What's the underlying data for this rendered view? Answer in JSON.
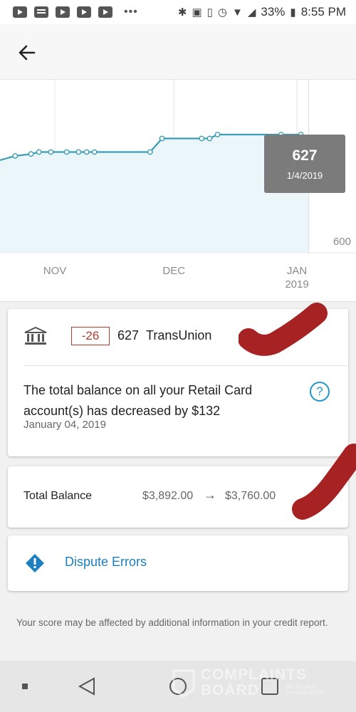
{
  "status_bar": {
    "battery": "33%",
    "time": "8:55 PM",
    "overflow": "•••",
    "app_icons": [
      "youtube-icon",
      "message-icon",
      "youtube-icon",
      "youtube-icon",
      "youtube-icon"
    ],
    "system_icons": [
      "bluetooth-icon",
      "nfc-icon",
      "vibrate-icon",
      "alarm-icon",
      "wifi-icon",
      "signal-icon",
      "battery-icon"
    ]
  },
  "app_bar": {
    "back_icon": "arrow-left-icon"
  },
  "chart_data": {
    "type": "line",
    "x_tick_labels": [
      "NOV",
      "DEC",
      "JAN\n2019"
    ],
    "y_tick_labels": [
      "600"
    ],
    "series": [
      {
        "values": [
          {
            "date": "2018-10-22",
            "score": 644
          },
          {
            "date": "2018-10-26",
            "score": 645
          },
          {
            "date": "2018-10-28",
            "score": 646
          },
          {
            "date": "2018-10-31",
            "score": 646
          },
          {
            "date": "2018-11-04",
            "score": 646
          },
          {
            "date": "2018-11-07",
            "score": 646
          },
          {
            "date": "2018-11-09",
            "score": 646
          },
          {
            "date": "2018-11-11",
            "score": 646
          },
          {
            "date": "2018-11-25",
            "score": 646
          },
          {
            "date": "2018-11-28",
            "score": 653
          },
          {
            "date": "2018-12-08",
            "score": 653
          },
          {
            "date": "2018-12-10",
            "score": 653
          },
          {
            "date": "2018-12-12",
            "score": 655
          },
          {
            "date": "2018-12-28",
            "score": 655
          },
          {
            "date": "2019-01-02",
            "score": 655
          },
          {
            "date": "2019-01-04",
            "score": 627
          }
        ]
      }
    ],
    "tooltip": {
      "score": "627",
      "date": "1/4/2019"
    },
    "line_color": "#3a9db3",
    "fill_color": "#eaf6fa",
    "grid": "vertical"
  },
  "alert_card": {
    "bureau_icon": "bank-icon",
    "delta": "-26",
    "score": "627",
    "bureau": "TransUnion",
    "description": "The total balance on all your Retail Card account(s) has decreased by $132",
    "date": "January 04, 2019",
    "help_icon": "?"
  },
  "balance_card": {
    "label": "Total Balance",
    "old_value": "$3,892.00",
    "arrow": "→",
    "new_value": "$3,760.00"
  },
  "dispute_card": {
    "icon": "alert-diamond-icon",
    "label": "Dispute Errors"
  },
  "footnote": "Your score may be affected by additional information in your credit report.",
  "watermark": {
    "line1": "COMPLAINTS",
    "line2": "BOARD",
    "sub": "WE BELIEVE\nIN YOUR VOICE"
  },
  "colors": {
    "accent_blue": "#1b7fc0",
    "badge_red": "#b03a2e",
    "marker_red": "#a01010"
  }
}
